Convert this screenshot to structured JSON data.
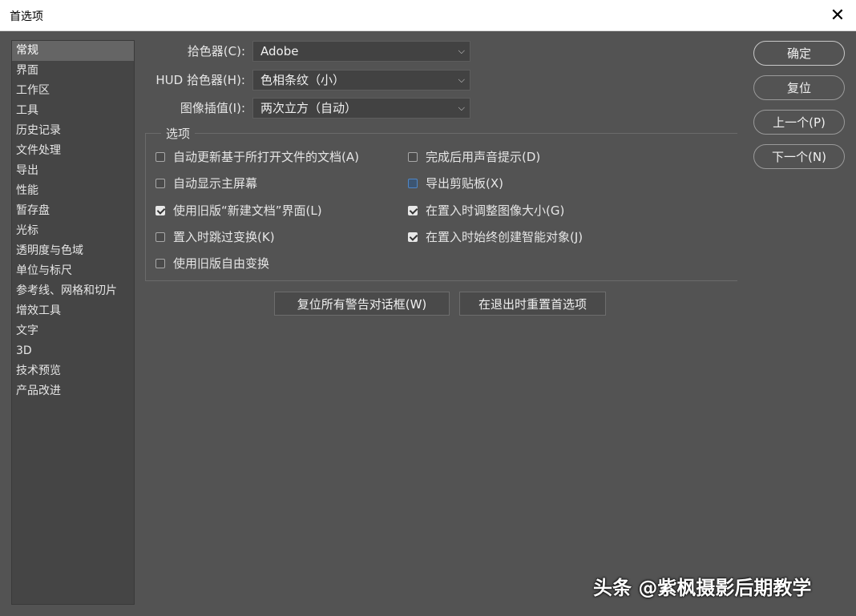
{
  "window": {
    "title": "首选项",
    "close_glyph": "✕"
  },
  "sidebar": {
    "items": [
      {
        "label": "常规",
        "selected": true
      },
      {
        "label": "界面"
      },
      {
        "label": "工作区"
      },
      {
        "label": "工具"
      },
      {
        "label": "历史记录"
      },
      {
        "label": "文件处理"
      },
      {
        "label": "导出"
      },
      {
        "label": "性能"
      },
      {
        "label": "暂存盘"
      },
      {
        "label": "光标"
      },
      {
        "label": "透明度与色域"
      },
      {
        "label": "单位与标尺"
      },
      {
        "label": "参考线、网格和切片"
      },
      {
        "label": "增效工具"
      },
      {
        "label": "文字"
      },
      {
        "label": "3D"
      },
      {
        "label": "技术预览"
      },
      {
        "label": "产品改进"
      }
    ]
  },
  "fields": {
    "color_picker": {
      "label": "拾色器(C):",
      "value": "Adobe"
    },
    "hud_color_picker": {
      "label": "HUD 拾色器(H):",
      "value": "色相条纹（小）"
    },
    "image_interpolation": {
      "label": "图像插值(I):",
      "value": "两次立方（自动）"
    },
    "chevron": "⌵"
  },
  "options": {
    "title": "选项",
    "left": [
      {
        "label": "自动更新基于所打开文件的文档(A)",
        "checked": false
      },
      {
        "label": "自动显示主屏幕",
        "checked": false
      },
      {
        "label": "使用旧版“新建文档”界面(L)",
        "checked": true
      },
      {
        "label": "置入时跳过变换(K)",
        "checked": false
      },
      {
        "label": "使用旧版自由变换",
        "checked": false
      }
    ],
    "right": [
      {
        "label": "完成后用声音提示(D)",
        "checked": false
      },
      {
        "label": "导出剪贴板(X)",
        "checked": false,
        "focused": true
      },
      {
        "label": "在置入时调整图像大小(G)",
        "checked": true
      },
      {
        "label": "在置入时始终创建智能对象(J)",
        "checked": true
      }
    ]
  },
  "buttons": {
    "reset_warnings": "复位所有警告对话框(W)",
    "reset_on_quit": "在退出时重置首选项",
    "ok": "确定",
    "reset": "复位",
    "prev": "上一个(P)",
    "next": "下一个(N)"
  },
  "watermark": "头条 @紫枫摄影后期教学"
}
